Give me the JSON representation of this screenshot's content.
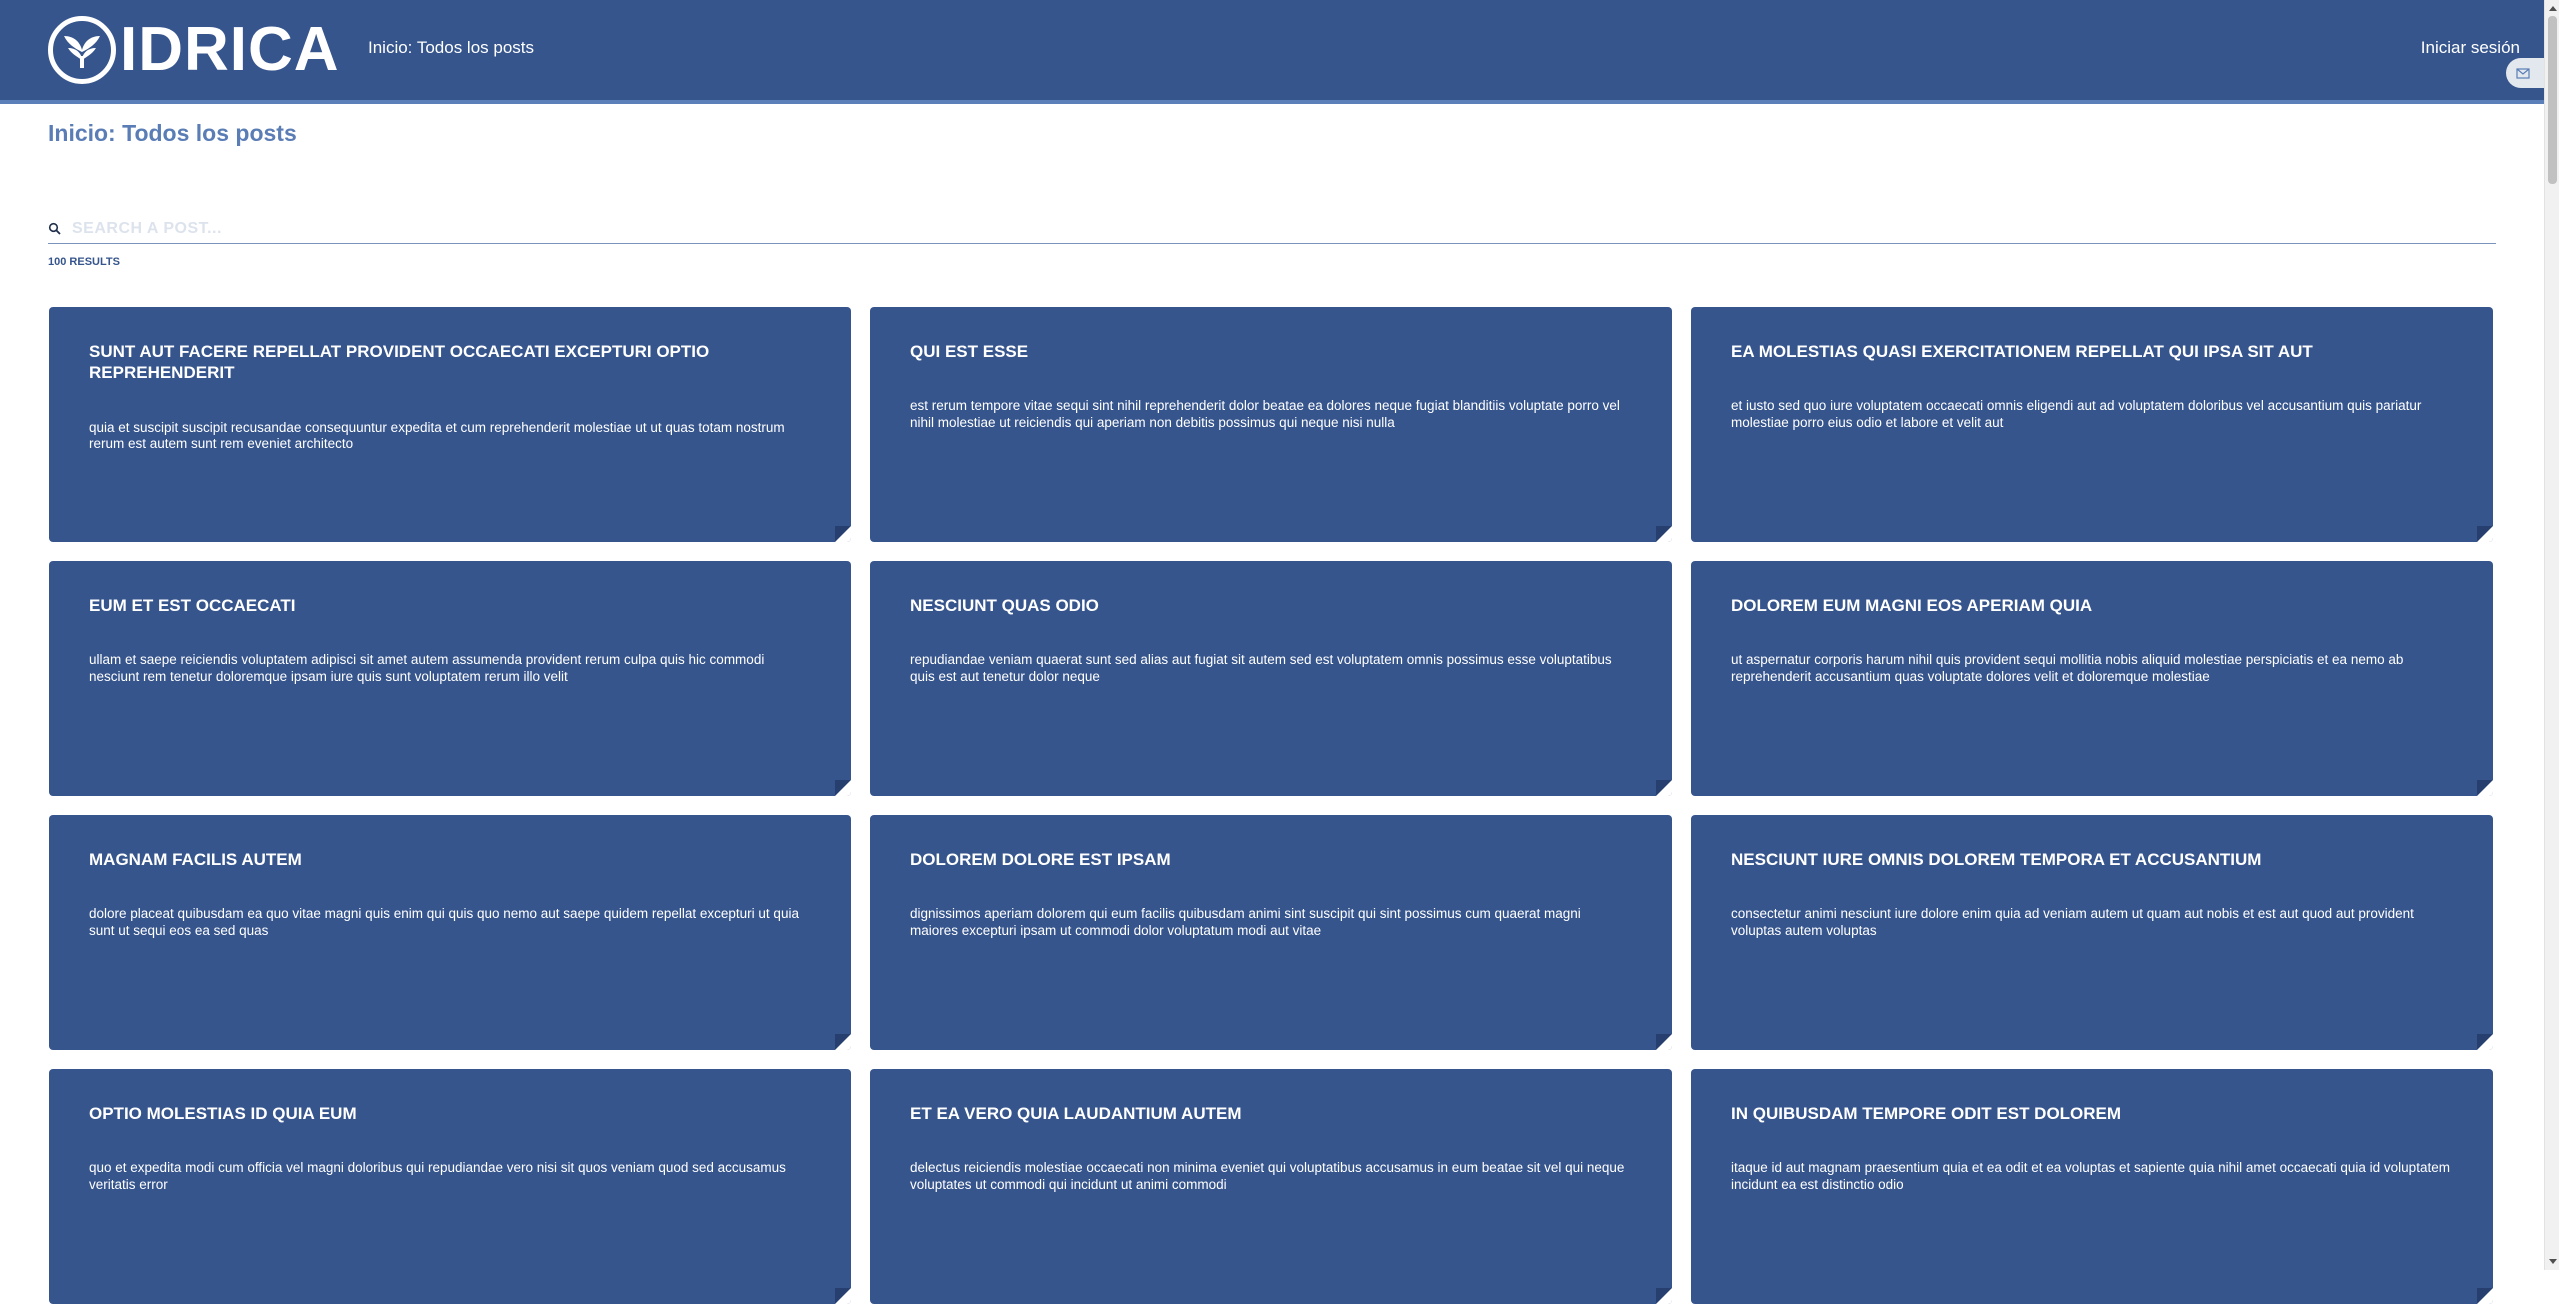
{
  "header": {
    "brand": "IDRICA",
    "title": "Inicio: Todos los posts",
    "login_label": "Iniciar sesión",
    "color": "#36558d"
  },
  "page": {
    "title": "Inicio: Todos los posts"
  },
  "search": {
    "placeholder": "SEARCH A POST...",
    "value": "",
    "icon": "search-icon"
  },
  "results": {
    "label": "100 RESULTS"
  },
  "posts": [
    {
      "title": "sunt aut facere repellat provident occaecati excepturi optio reprehenderit",
      "body": "quia et suscipit suscipit recusandae consequuntur expedita et cum reprehenderit molestiae ut ut quas totam nostrum rerum est autem sunt rem eveniet architecto"
    },
    {
      "title": "qui est esse",
      "body": "est rerum tempore vitae sequi sint nihil reprehenderit dolor beatae ea dolores neque fugiat blanditiis voluptate porro vel nihil molestiae ut reiciendis qui aperiam non debitis possimus qui neque nisi nulla"
    },
    {
      "title": "ea molestias quasi exercitationem repellat qui ipsa sit aut",
      "body": "et iusto sed quo iure voluptatem occaecati omnis eligendi aut ad voluptatem doloribus vel accusantium quis pariatur molestiae porro eius odio et labore et velit aut"
    },
    {
      "title": "eum et est occaecati",
      "body": "ullam et saepe reiciendis voluptatem adipisci sit amet autem assumenda provident rerum culpa quis hic commodi nesciunt rem tenetur doloremque ipsam iure quis sunt voluptatem rerum illo velit"
    },
    {
      "title": "nesciunt quas odio",
      "body": "repudiandae veniam quaerat sunt sed alias aut fugiat sit autem sed est voluptatem omnis possimus esse voluptatibus quis est aut tenetur dolor neque"
    },
    {
      "title": "dolorem eum magni eos aperiam quia",
      "body": "ut aspernatur corporis harum nihil quis provident sequi mollitia nobis aliquid molestiae perspiciatis et ea nemo ab reprehenderit accusantium quas voluptate dolores velit et doloremque molestiae"
    },
    {
      "title": "magnam facilis autem",
      "body": "dolore placeat quibusdam ea quo vitae magni quis enim qui quis quo nemo aut saepe quidem repellat excepturi ut quia sunt ut sequi eos ea sed quas"
    },
    {
      "title": "dolorem dolore est ipsam",
      "body": "dignissimos aperiam dolorem qui eum facilis quibusdam animi sint suscipit qui sint possimus cum quaerat magni maiores excepturi ipsam ut commodi dolor voluptatum modi aut vitae"
    },
    {
      "title": "nesciunt iure omnis dolorem tempora et accusantium",
      "body": "consectetur animi nesciunt iure dolore enim quia ad veniam autem ut quam aut nobis et est aut quod aut provident voluptas autem voluptas"
    },
    {
      "title": "optio molestias id quia eum",
      "body": "quo et expedita modi cum officia vel magni doloribus qui repudiandae vero nisi sit quos veniam quod sed accusamus veritatis error"
    },
    {
      "title": "et ea vero quia laudantium autem",
      "body": "delectus reiciendis molestiae occaecati non minima eveniet qui voluptatibus accusamus in eum beatae sit vel qui neque voluptates ut commodi qui incidunt ut animi commodi"
    },
    {
      "title": "in quibusdam tempore odit est dolorem",
      "body": "itaque id aut magnam praesentium quia et ea odit et ea voluptas et sapiente quia nihil amet occaecati quia id voluptatem incidunt ea est distinctio odio"
    }
  ]
}
